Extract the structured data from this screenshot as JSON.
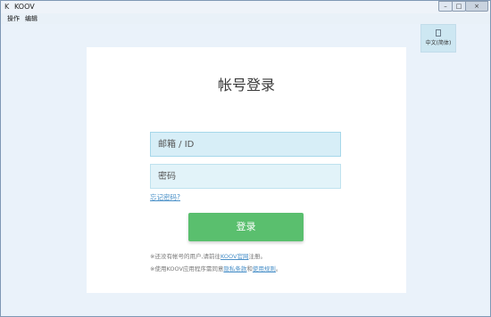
{
  "window": {
    "title": "KOOV",
    "app_icon": "K",
    "buttons": {
      "minimize": "–",
      "maximize": "□",
      "close": "×"
    }
  },
  "menu": [
    "操作",
    "编辑"
  ],
  "language_button": {
    "label": "中文(简体)",
    "icon": "document-icon"
  },
  "login": {
    "title": "帐号登录",
    "email_placeholder": "邮箱 / ID",
    "password_placeholder": "密码",
    "forgot_link": "忘记密码?",
    "login_button": "登录",
    "note1": {
      "prefix": "※还没有帐号的用户,请前往",
      "link": "KOOV官网",
      "suffix": "注册。"
    },
    "note2": {
      "prefix": "※使用KOOV应用程序需同意",
      "link1": "隐私条款",
      "middle": "和",
      "link2": "使用规则",
      "suffix": "。"
    }
  },
  "colors": {
    "accent_green": "#5abf6e",
    "field_bg": "#d7eef7",
    "link_blue": "#4a90c8"
  }
}
